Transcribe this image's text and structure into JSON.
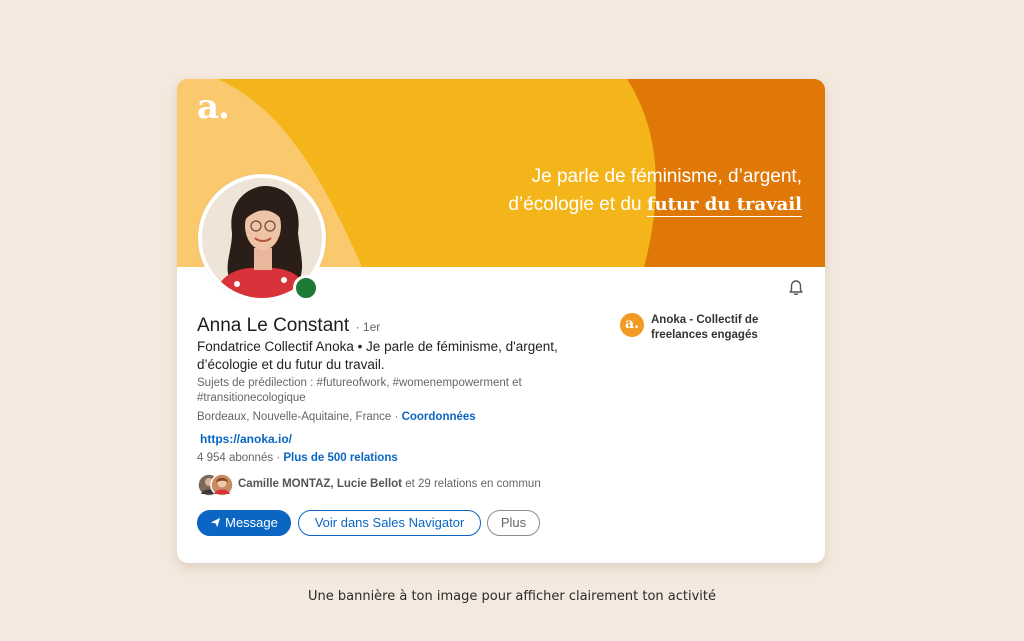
{
  "colors": {
    "page_background": "#f4e9de",
    "banner_yellow": "#f4b51b",
    "banner_light": "#fbc96d",
    "banner_orange": "#e07808",
    "brand_blue": "#0a66c2",
    "status_green": "#1d7a33"
  },
  "banner": {
    "logo": "a.",
    "tagline_line1": "Je parle de féminisme, d’argent,",
    "tagline_line2_prefix": "d’écologie et du ",
    "tagline_line2_emphasis": "futur du travail"
  },
  "profile": {
    "name": "Anna Le Constant",
    "degree": "· 1er",
    "headline": "Fondatrice Collectif Anoka • Je parle de féminisme, d'argent, d’écologie et du futur du travail.",
    "topics": "Sujets de prédilection : #futureofwork, #womenempowerment et #transitionecologique",
    "location": "Bordeaux, Nouvelle-Aquitaine, France · ",
    "contact_link": "Coordonnées",
    "website": "https://anoka.io/",
    "followers": "4 954 abonnés",
    "stats_separator": " · ",
    "connections_link": "Plus de 500 relations",
    "mutual_names": "Camille MONTAZ, Lucie Bellot",
    "mutual_suffix": " et 29 relations en commun",
    "online": true
  },
  "company": {
    "logo_letter": "a.",
    "name": "Anoka - Collectif de freelances engagés"
  },
  "actions": {
    "message": "Message",
    "sales_navigator": "Voir dans Sales Navigator",
    "more": "Plus"
  },
  "icons": {
    "bell": "bell-icon",
    "send": "send-icon"
  },
  "caption": "Une bannière à ton image pour afficher clairement ton activité"
}
